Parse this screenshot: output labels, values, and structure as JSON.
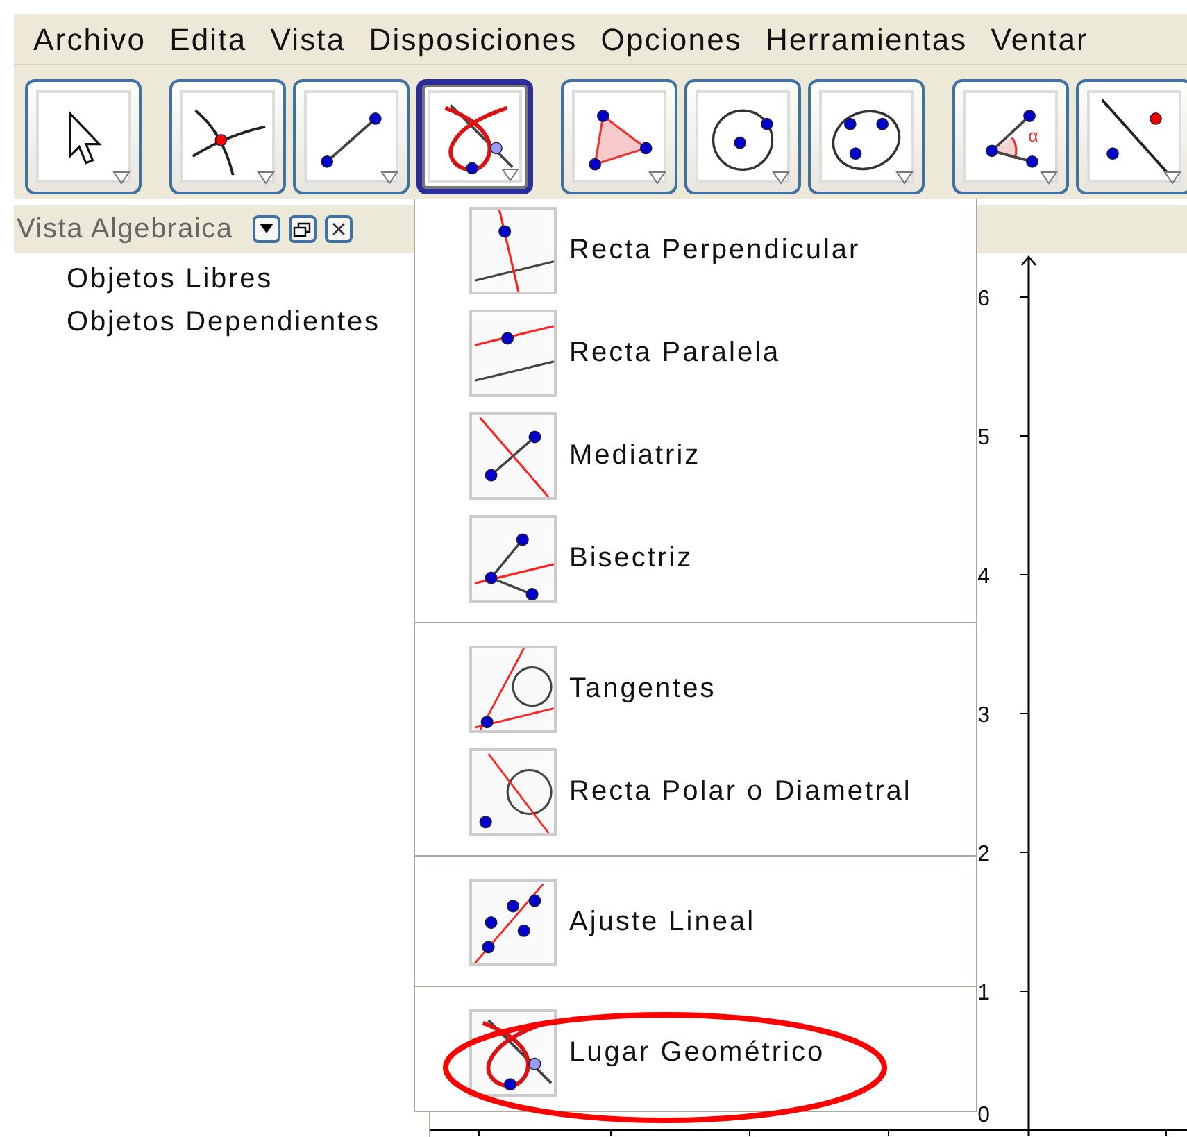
{
  "menu_bar": [
    "Archivo",
    "Edita",
    "Vista",
    "Disposiciones",
    "Opciones",
    "Herramientas",
    "Ventar"
  ],
  "toolbar": [
    [
      {
        "kind": "pointer",
        "selected": false
      }
    ],
    [
      {
        "kind": "intersect",
        "selected": false
      },
      {
        "kind": "segment",
        "selected": false
      },
      {
        "kind": "locus",
        "selected": true
      }
    ],
    [
      {
        "kind": "polygon",
        "selected": false
      },
      {
        "kind": "circle",
        "selected": false
      },
      {
        "kind": "conic",
        "selected": false
      }
    ],
    [
      {
        "kind": "angle",
        "glyph": "α",
        "selected": false
      },
      {
        "kind": "reflect",
        "selected": false
      }
    ]
  ],
  "algebra_view": {
    "title": "Vista Algebraica",
    "items": [
      "Objetos Libres",
      "Objetos Dependientes"
    ]
  },
  "graphics_view": {
    "y_axis_labels": [
      "6",
      "5",
      "4",
      "3",
      "2",
      "1",
      "0"
    ]
  },
  "tool_menu": {
    "groups": [
      [
        {
          "label": "Recta Perpendicular",
          "kind": "perpendicular",
          "circled": false
        },
        {
          "label": "Recta Paralela",
          "kind": "parallel",
          "circled": false
        },
        {
          "label": "Mediatriz",
          "kind": "perpendicular-bisector",
          "circled": false
        },
        {
          "label": "Bisectriz",
          "kind": "angle-bisector",
          "circled": false
        }
      ],
      [
        {
          "label": "Tangentes",
          "kind": "tangents",
          "circled": false
        },
        {
          "label": "Recta Polar o Diametral",
          "kind": "polar",
          "circled": false
        }
      ],
      [
        {
          "label": "Ajuste Lineal",
          "kind": "fit-line",
          "circled": false
        }
      ],
      [
        {
          "label": "Lugar Geométrico",
          "kind": "locus",
          "circled": true
        }
      ]
    ]
  }
}
